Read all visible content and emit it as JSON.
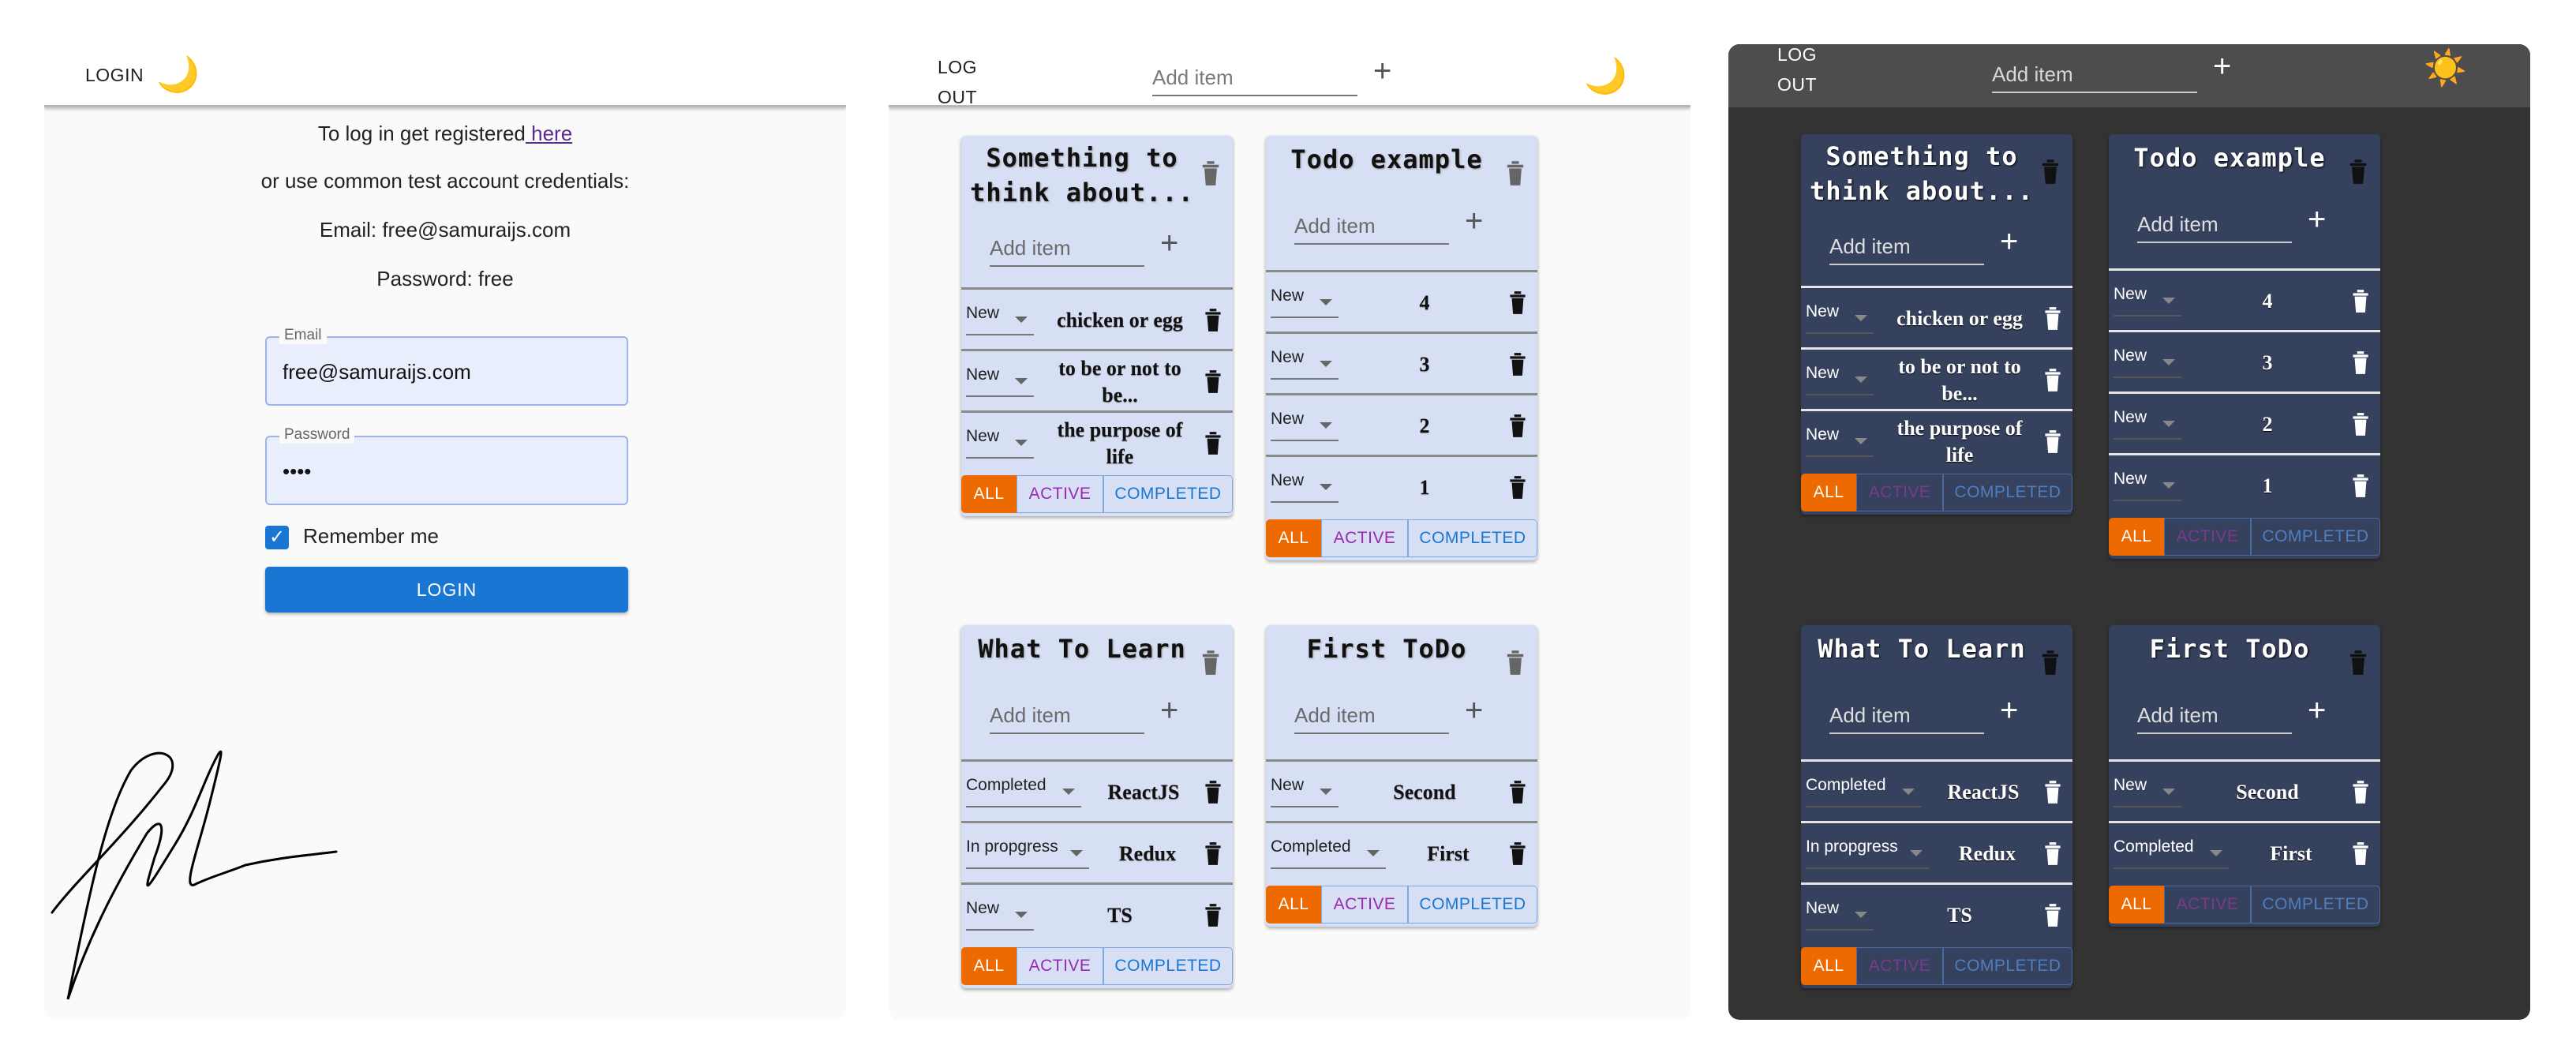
{
  "login_panel": {
    "header_login": "LOGIN",
    "theme_icon": "moon-icon",
    "info_line1_prefix": "To log in get registered",
    "info_link": " here",
    "info_line2": "or use common test account credentials:",
    "info_line3": "Email: free@samuraijs.com",
    "info_line4": "Password: free",
    "email_label": "Email",
    "email_value": "free@samuraijs.com",
    "password_label": "Password",
    "password_value": "••••",
    "remember_label": "Remember me",
    "remember_checked": true,
    "login_button": "LOGIN",
    "signature": "handwritten signature"
  },
  "app": {
    "logout_line1": "LOG",
    "logout_line2": "OUT",
    "add_placeholder": "Add item",
    "plus": "+",
    "filters": {
      "all": "ALL",
      "active": "ACTIVE",
      "completed": "COMPLETED"
    },
    "accent": "#ec6a00",
    "light_card_color": "#d7dff5",
    "dark_card_color": "#36415d",
    "light_theme_icon": "moon-icon",
    "dark_theme_icon": "sun-icon",
    "lists": [
      {
        "title": "Something to think about...",
        "tasks": [
          {
            "status": "New",
            "text": "chicken or egg"
          },
          {
            "status": "New",
            "text": "to be or not to be..."
          },
          {
            "status": "New",
            "text": "the purpose of life"
          }
        ]
      },
      {
        "title": "Todo example",
        "tasks": [
          {
            "status": "New",
            "text": "4"
          },
          {
            "status": "New",
            "text": "3"
          },
          {
            "status": "New",
            "text": "2"
          },
          {
            "status": "New",
            "text": "1"
          }
        ]
      },
      {
        "title": "What To Learn",
        "tasks": [
          {
            "status": "Completed",
            "text": "ReactJS"
          },
          {
            "status": "In propgress",
            "text": "Redux"
          },
          {
            "status": "New",
            "text": "TS"
          }
        ]
      },
      {
        "title": "First ToDo",
        "tasks": [
          {
            "status": "New",
            "text": "Second"
          },
          {
            "status": "Completed",
            "text": "First"
          }
        ]
      }
    ]
  }
}
